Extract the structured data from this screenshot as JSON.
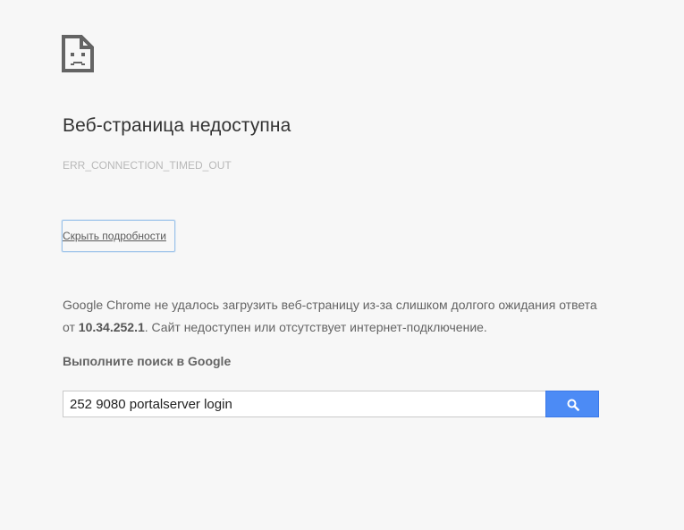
{
  "page": {
    "icon": "sad-page-icon",
    "title": "Веб-страница недоступна",
    "error_code": "ERR_CONNECTION_TIMED_OUT",
    "details_button_label": "Скрыть подробности",
    "explanation": {
      "part1": "Google Chrome не удалось загрузить веб-страницу из-за слишком долгого ожидания ответа от ",
      "host": "10.34.252.1",
      "part2": ". Сайт недоступен или отсутствует интернет-подключение."
    },
    "search": {
      "heading": "Выполните поиск в Google",
      "query": "252 9080 portalserver login",
      "button_icon": "search-icon"
    }
  },
  "colors": {
    "background": "#f7f7f7",
    "title": "#333333",
    "text": "#646464",
    "error_code": "#b8b8b8",
    "search_button": "#4c8bf5"
  }
}
